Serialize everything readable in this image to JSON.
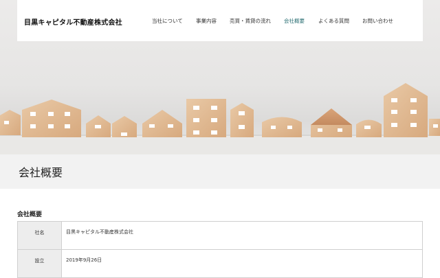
{
  "header": {
    "logo": "目黒キャピタル不動産株式会社",
    "nav": [
      {
        "label": "当社について",
        "active": false
      },
      {
        "label": "事業内容",
        "active": false
      },
      {
        "label": "売買・賃貸の流れ",
        "active": false
      },
      {
        "label": "会社概要",
        "active": true
      },
      {
        "label": "よくある質問",
        "active": false
      },
      {
        "label": "お問い合わせ",
        "active": false
      }
    ],
    "active_color": "#2a6f73"
  },
  "hero": {
    "image": "wooden-toy-houses"
  },
  "page": {
    "title": "会社概要"
  },
  "section": {
    "title": "会社概要",
    "rows": [
      {
        "label": "社名",
        "value": "目黒キャピタル不動産株式会社"
      },
      {
        "label": "設立",
        "value": "2019年9月26日"
      }
    ]
  }
}
